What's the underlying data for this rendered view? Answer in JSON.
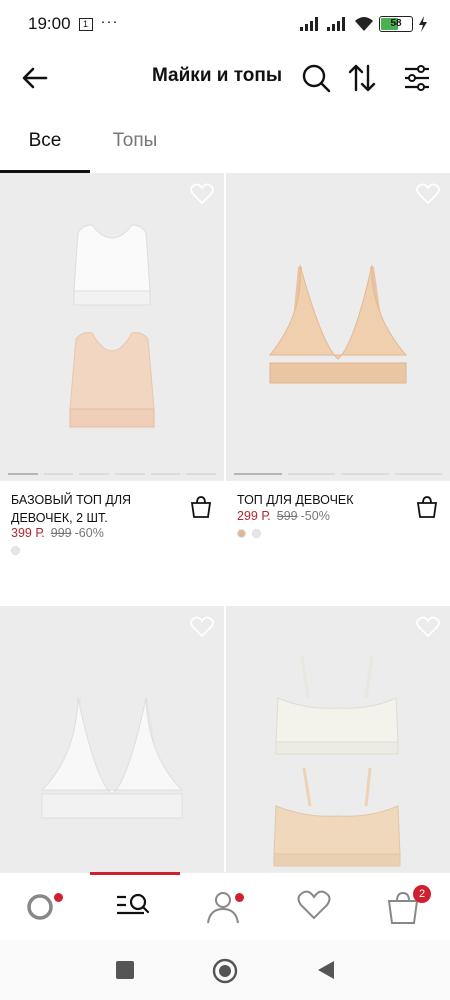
{
  "status": {
    "time": "19:00",
    "notif_box": "1",
    "dots": "···",
    "battery": "58",
    "battery_level": 0.58
  },
  "header": {
    "title": "Майки и топы",
    "back_icon": "arrow-left-icon",
    "icons": [
      "search-icon",
      "sort-icon",
      "filter-icon"
    ]
  },
  "tabs": [
    {
      "label": "Все",
      "active": true
    },
    {
      "label": "Топы",
      "active": false
    }
  ],
  "products": [
    {
      "name": "Базовый топ для девочек, 2 шт.",
      "price": "399 Р.",
      "old_price": "999",
      "discount": "-60%",
      "swatches": [
        "#e6e6e6"
      ]
    },
    {
      "name": "Топ для девочек",
      "price": "299 Р.",
      "old_price": "599",
      "discount": "-50%",
      "swatches": [
        "#dfb896",
        "#e6e6e6"
      ]
    },
    {
      "name": "",
      "price": "",
      "old_price": "",
      "discount": "",
      "swatches": []
    },
    {
      "name": "",
      "price": "",
      "old_price": "",
      "discount": "",
      "swatches": []
    }
  ],
  "bottom_nav": [
    {
      "icon": "home-icon",
      "dot": true
    },
    {
      "icon": "catalog-search-icon",
      "active": true
    },
    {
      "icon": "profile-icon",
      "dot": true
    },
    {
      "icon": "favorites-icon"
    },
    {
      "icon": "cart-icon",
      "badge": "2"
    }
  ],
  "colors": {
    "accent": "#d01f2e",
    "price": "#b3262e",
    "image_bg": "#ececec"
  }
}
